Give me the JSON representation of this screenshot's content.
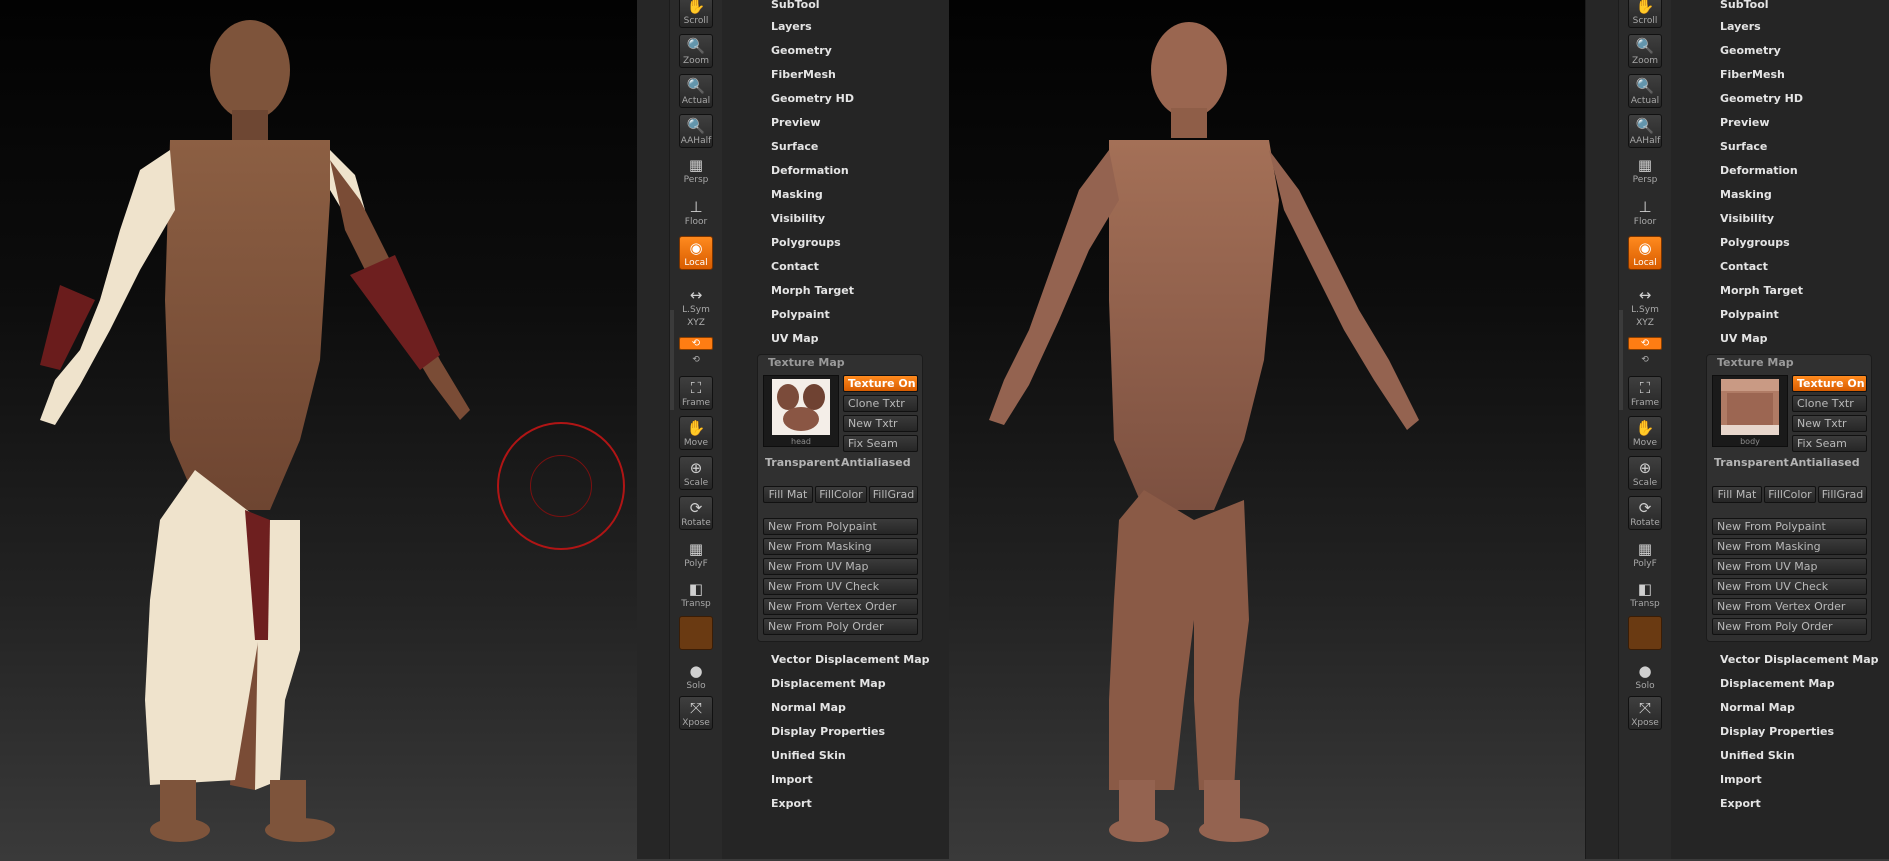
{
  "toolbar": {
    "buttons": [
      {
        "label": "Scroll",
        "glyph": "✋"
      },
      {
        "label": "Zoom",
        "glyph": "🔍"
      },
      {
        "label": "Actual",
        "glyph": "🔍"
      },
      {
        "label": "AAHalf",
        "glyph": "🔍"
      },
      {
        "label": "Persp",
        "glyph": "▦"
      },
      {
        "label": "Floor",
        "glyph": "⊥"
      },
      {
        "label": "Local",
        "glyph": "◉"
      },
      {
        "label": "L.Sym",
        "glyph": "↔"
      },
      {
        "label": "XYZ",
        "glyph": "⟲"
      },
      {
        "label": "Frame",
        "glyph": "⛶"
      },
      {
        "label": "Move",
        "glyph": "✋"
      },
      {
        "label": "Scale",
        "glyph": "⊕"
      },
      {
        "label": "Rotate",
        "glyph": "⟳"
      },
      {
        "label": "PolyF",
        "glyph": "▦"
      },
      {
        "label": "Transp",
        "glyph": "◧"
      },
      {
        "label": "Solo",
        "glyph": "●"
      },
      {
        "label": "Xpose",
        "glyph": "⤧"
      }
    ]
  },
  "panel": {
    "menu_top": [
      "SubTool",
      "Layers",
      "Geometry",
      "FiberMesh",
      "Geometry HD",
      "Preview",
      "Surface",
      "Deformation",
      "Masking",
      "Visibility",
      "Polygroups",
      "Contact",
      "Morph Target",
      "Polypaint",
      "UV Map"
    ],
    "texture_map": {
      "title": "Texture Map",
      "side_buttons": [
        "Texture On",
        "Clone Txtr",
        "New Txtr",
        "Fix Seam"
      ],
      "transparent": "Transparent",
      "antialiased": "Antialiased",
      "fill_buttons": [
        "Fill Mat",
        "FillColor",
        "FillGrad"
      ],
      "new_from": [
        "New From Polypaint",
        "New From Masking",
        "New From UV Map",
        "New From UV Check",
        "New From Vertex Order",
        "New From Poly Order"
      ]
    },
    "menu_bottom": [
      "Vector Displacement Map",
      "Displacement Map",
      "Normal Map",
      "Display Properties",
      "Unified Skin",
      "Import",
      "Export"
    ]
  },
  "left": {
    "thumb_caption": "head"
  },
  "right": {
    "thumb_caption": "body"
  },
  "colors": {
    "accent": "#ff7d13",
    "panel": "#252525",
    "text": "#e4e4e4"
  }
}
